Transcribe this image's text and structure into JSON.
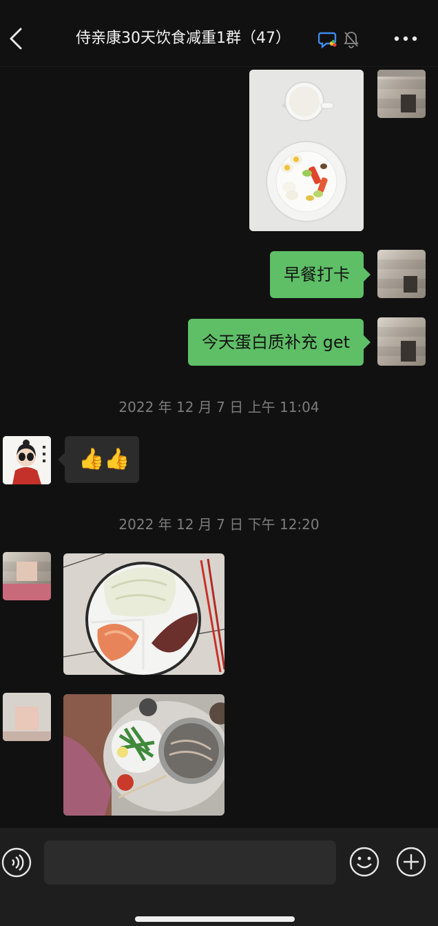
{
  "header": {
    "title": "侍亲康30天饮食减重1群（47）",
    "back_icon": "chevron-left-icon",
    "chat_icon": "group-chat-icon",
    "mute_icon": "bell-slash-icon",
    "more_icon": "ellipsis-icon"
  },
  "messages": [
    {
      "side": "right",
      "type": "image",
      "subject": "breakfast plate with milk, eggs and vegetables"
    },
    {
      "side": "right",
      "type": "text",
      "text": "早餐打卡"
    },
    {
      "side": "right",
      "type": "text",
      "text": "今天蛋白质补充 get"
    },
    {
      "type": "timestamp",
      "text": "2022 年 12 月 7 日 上午 11:04"
    },
    {
      "side": "left",
      "type": "text",
      "text": "👍👍"
    },
    {
      "type": "timestamp",
      "text": "2022 年 12 月 7 日 下午 12:20"
    },
    {
      "side": "left",
      "type": "image",
      "subject": "plate with cabbage, shrimp and sweet potato"
    },
    {
      "side": "left",
      "type": "image",
      "subject": "table with greens, tomato and noodle bowl"
    }
  ],
  "input_bar": {
    "voice_icon": "voice-icon",
    "emoji_icon": "emoji-icon",
    "plus_icon": "plus-circle-icon",
    "draft": ""
  },
  "colors": {
    "background": "#111111",
    "my_bubble": "#5fbf67",
    "other_bubble": "#2c2c2c",
    "timestamp": "#7d7d7d"
  }
}
